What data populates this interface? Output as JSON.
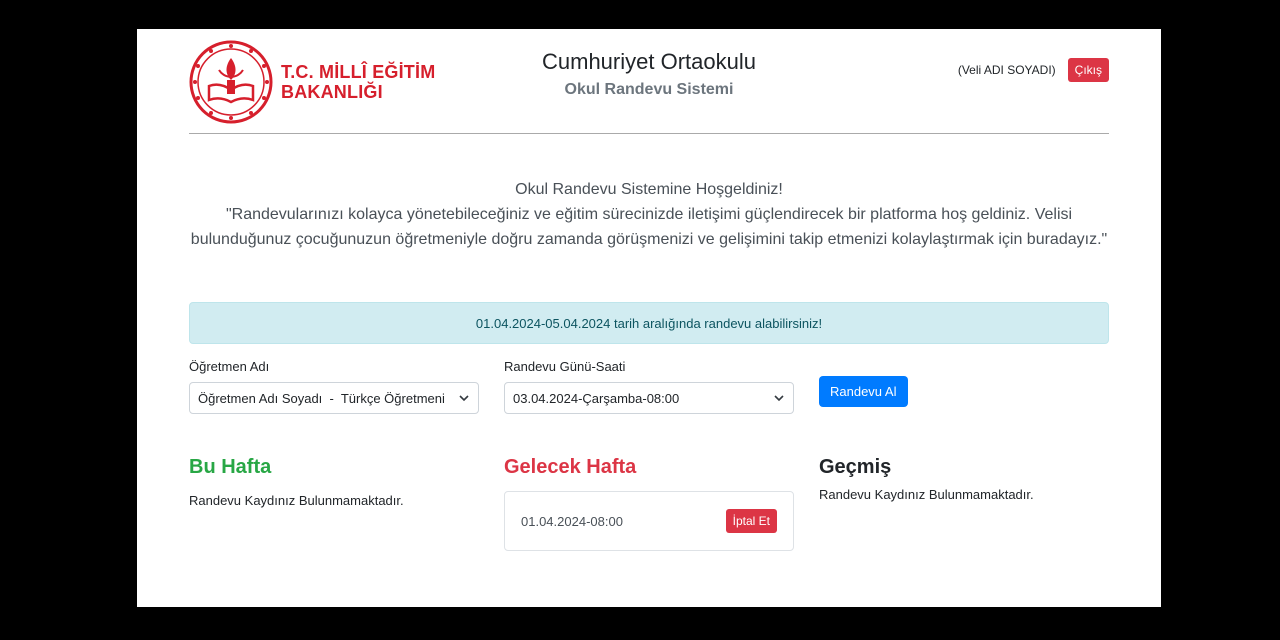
{
  "header": {
    "logo_line1": "T.C. MİLLÎ EĞİTİM",
    "logo_line2": "BAKANLIĞI",
    "school_name": "Cumhuriyet Ortaokulu",
    "system_name": "Okul Randevu Sistemi",
    "user_name": "(Veli ADI SOYADI)",
    "exit_label": "Çıkış"
  },
  "welcome": {
    "title": "Okul Randevu Sistemine Hoşgeldiniz!",
    "line1": "\"Randevularınızı kolayca yönetebileceğiniz ve eğitim sürecinizde iletişimi güçlendirecek bir platforma hoş geldiniz. Velisi",
    "line2": "bulunduğunuz çocuğunuzun öğretmeniyle doğru zamanda görüşmenizi ve gelişimini takip etmenizi kolaylaştırmak için buradayız.\""
  },
  "alert": {
    "text": "01.04.2024-05.04.2024 tarih aralığında randevu alabilirsiniz!"
  },
  "form": {
    "teacher_label": "Öğretmen Adı",
    "teacher_value": "Öğretmen Adı Soyadı  -  Türkçe Öğretmeni",
    "datetime_label": "Randevu Günü-Saati",
    "datetime_value": "03.04.2024-Çarşamba-08:00",
    "submit_label": "Randevu Al"
  },
  "this_week": {
    "title": "Bu Hafta",
    "empty_text": "Randevu Kaydınız Bulunmamaktadır."
  },
  "next_week": {
    "title": "Gelecek Hafta",
    "appointments": [
      {
        "datetime": "01.04.2024-08:00",
        "cancel_label": "İptal Et"
      }
    ]
  },
  "past": {
    "title": "Geçmiş",
    "empty_text": "Randevu Kaydınız Bulunmamaktadır."
  },
  "colors": {
    "brand_red": "#d61f2c",
    "danger": "#dc3545",
    "primary": "#007bff",
    "success": "#28a745",
    "info_bg": "#d1ecf1"
  },
  "icons": {
    "logo": "meb-emblem-icon",
    "select_arrow": "chevron-down-icon"
  }
}
